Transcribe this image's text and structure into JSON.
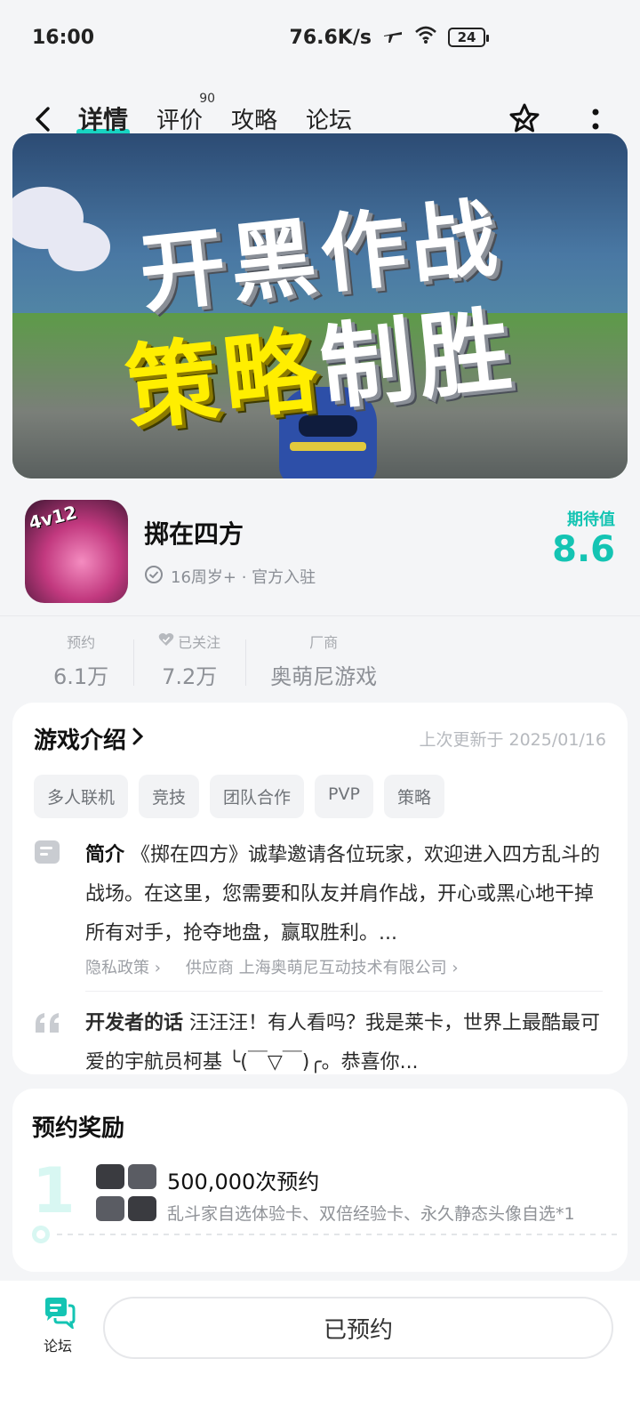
{
  "status_bar": {
    "time": "16:00",
    "network_speed": "76.6K/s",
    "battery": "24",
    "icons": [
      "airplane-icon",
      "wifi-icon",
      "battery-icon"
    ]
  },
  "nav": {
    "tabs": [
      {
        "label": "详情",
        "active": true
      },
      {
        "label": "评价",
        "badge": "90"
      },
      {
        "label": "攻略"
      },
      {
        "label": "论坛"
      }
    ]
  },
  "banner": {
    "line1": "开黑作战",
    "line2_yellow": "策略",
    "line2_white": "制胜"
  },
  "game": {
    "icon_text": "4v12",
    "name": "掷在四方",
    "sub": "16周岁+ · 官方入驻",
    "score_label": "期待值",
    "score": "8.6"
  },
  "stats": [
    {
      "label": "预约",
      "value": "6.1万"
    },
    {
      "label": "已关注",
      "value": "7.2万"
    },
    {
      "label": "厂商",
      "value": "奥萌尼游戏"
    }
  ],
  "intro": {
    "title": "游戏介绍",
    "updated": "上次更新于 2025/01/16",
    "tags": [
      "多人联机",
      "竞技",
      "团队合作",
      "PVP",
      "策略"
    ],
    "summary_label": "简介",
    "summary": "《掷在四方》诚挚邀请各位玩家，欢迎进入四方乱斗的战场。在这里，您需要和队友并肩作战，开心或黑心地干掉所有对手，抢夺地盘，赢取胜利。...",
    "privacy_link": "隐私政策",
    "supplier_link": "供应商 上海奥萌尼互动技术有限公司",
    "dev_label": "开发者的话",
    "dev_text": "汪汪汪！有人看吗？我是莱卡，世界上最酷最可爱的宇航员柯基 ╰(￣▽￣)╭。恭喜你..."
  },
  "reward": {
    "title": "预约奖励",
    "index": "1",
    "count": "500,000次预约",
    "desc": "乱斗家自选体验卡、双倍经验卡、永久静态头像自选*1"
  },
  "bottom": {
    "forum_label": "论坛",
    "reserve_label": "已预约"
  },
  "colors": {
    "accent": "#14c4b3",
    "tab_underline": "#18d4c2",
    "banner_yellow": "#ffee00"
  }
}
